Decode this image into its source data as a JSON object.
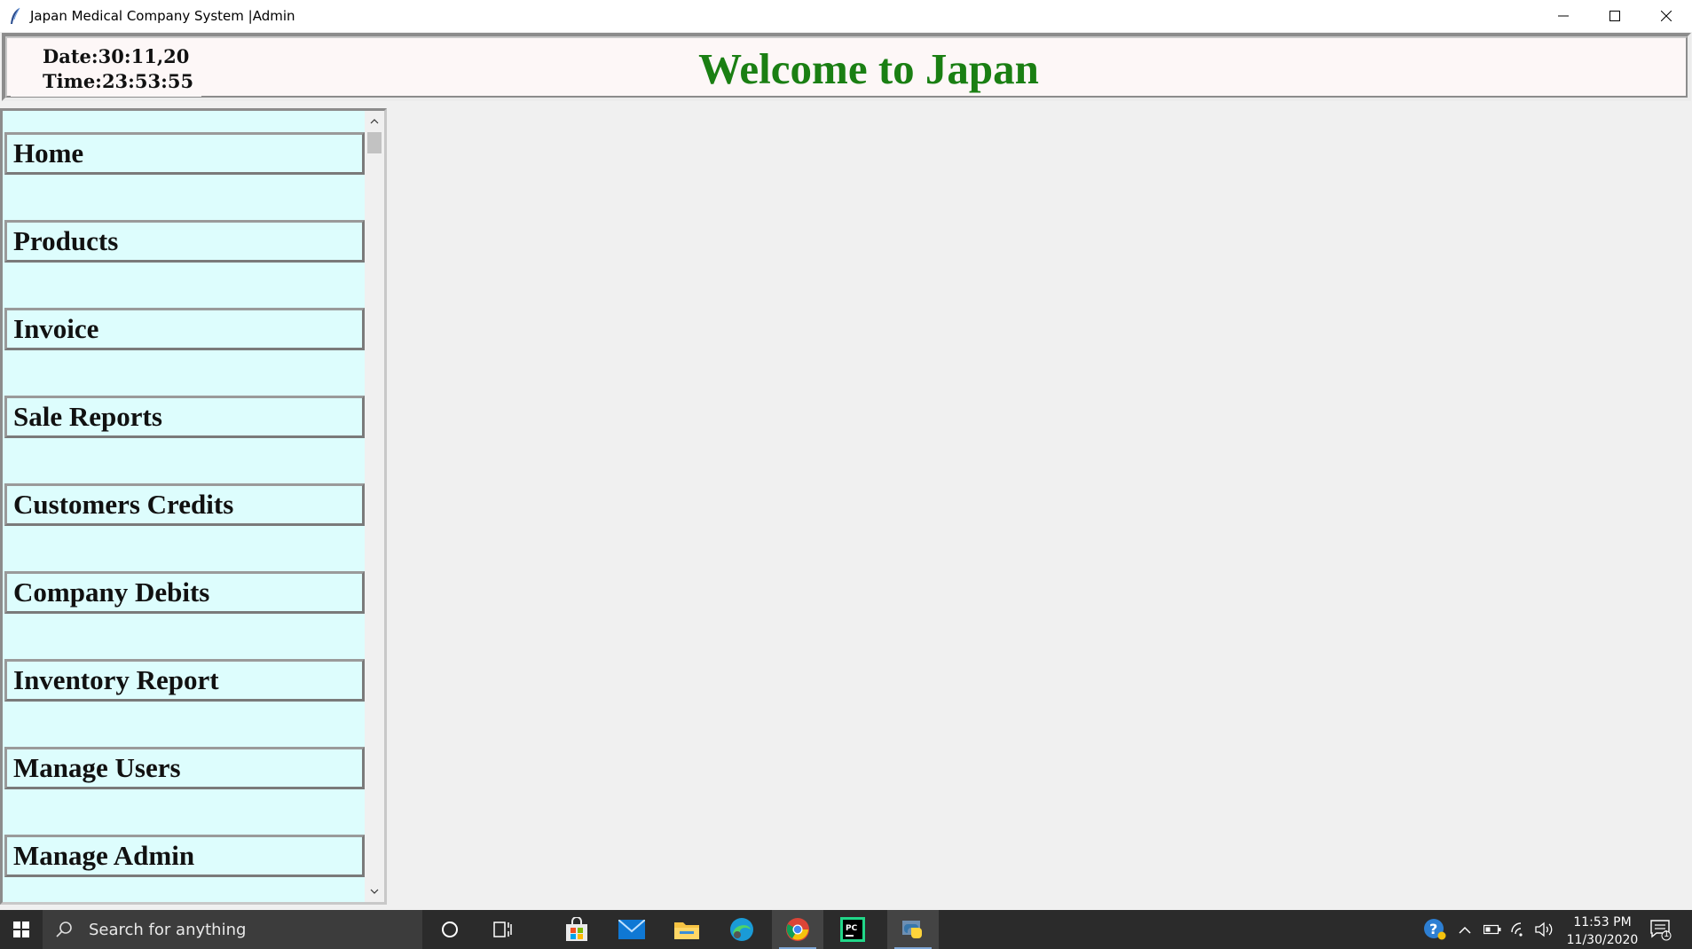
{
  "window": {
    "title": "Japan Medical Company System |Admin",
    "icon": "feather-icon"
  },
  "header": {
    "date": "Date:30:11,20",
    "time": "Time:23:53:55",
    "welcome": "Welcome to Japan",
    "welcome_color": "#1a7f13"
  },
  "sidebar": {
    "background": "#ddfdfd",
    "items": [
      {
        "label": "Home"
      },
      {
        "label": "Products"
      },
      {
        "label": "Invoice"
      },
      {
        "label": "Sale Reports"
      },
      {
        "label": "Customers Credits"
      },
      {
        "label": "Company Debits"
      },
      {
        "label": "Inventory Report"
      },
      {
        "label": "Manage Users"
      },
      {
        "label": "Manage Admin"
      }
    ]
  },
  "taskbar": {
    "search_placeholder": "Search for anything",
    "clock_time": "11:53 PM",
    "clock_date": "11/30/2020",
    "notification_count": "1",
    "apps": [
      "cortana-icon",
      "task-view-icon",
      "store-icon",
      "mail-icon",
      "file-explorer-icon",
      "edge-icon",
      "chrome-icon",
      "pycharm-icon",
      "python-icon"
    ]
  }
}
